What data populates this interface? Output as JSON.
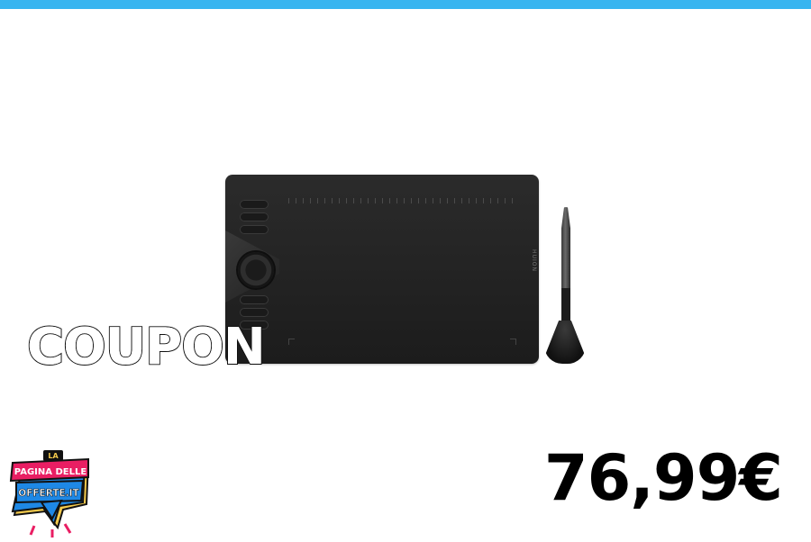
{
  "banner": {
    "coupon_label": "COUPON",
    "price": "76,99€",
    "accent_color": "#38b5f0"
  },
  "product": {
    "brand_mark": "HUION",
    "image": "drawing-tablet-with-pen"
  },
  "logo": {
    "line1": "LA",
    "line2": "PAGINA DELLE",
    "line3": "OFFERTE.IT"
  }
}
